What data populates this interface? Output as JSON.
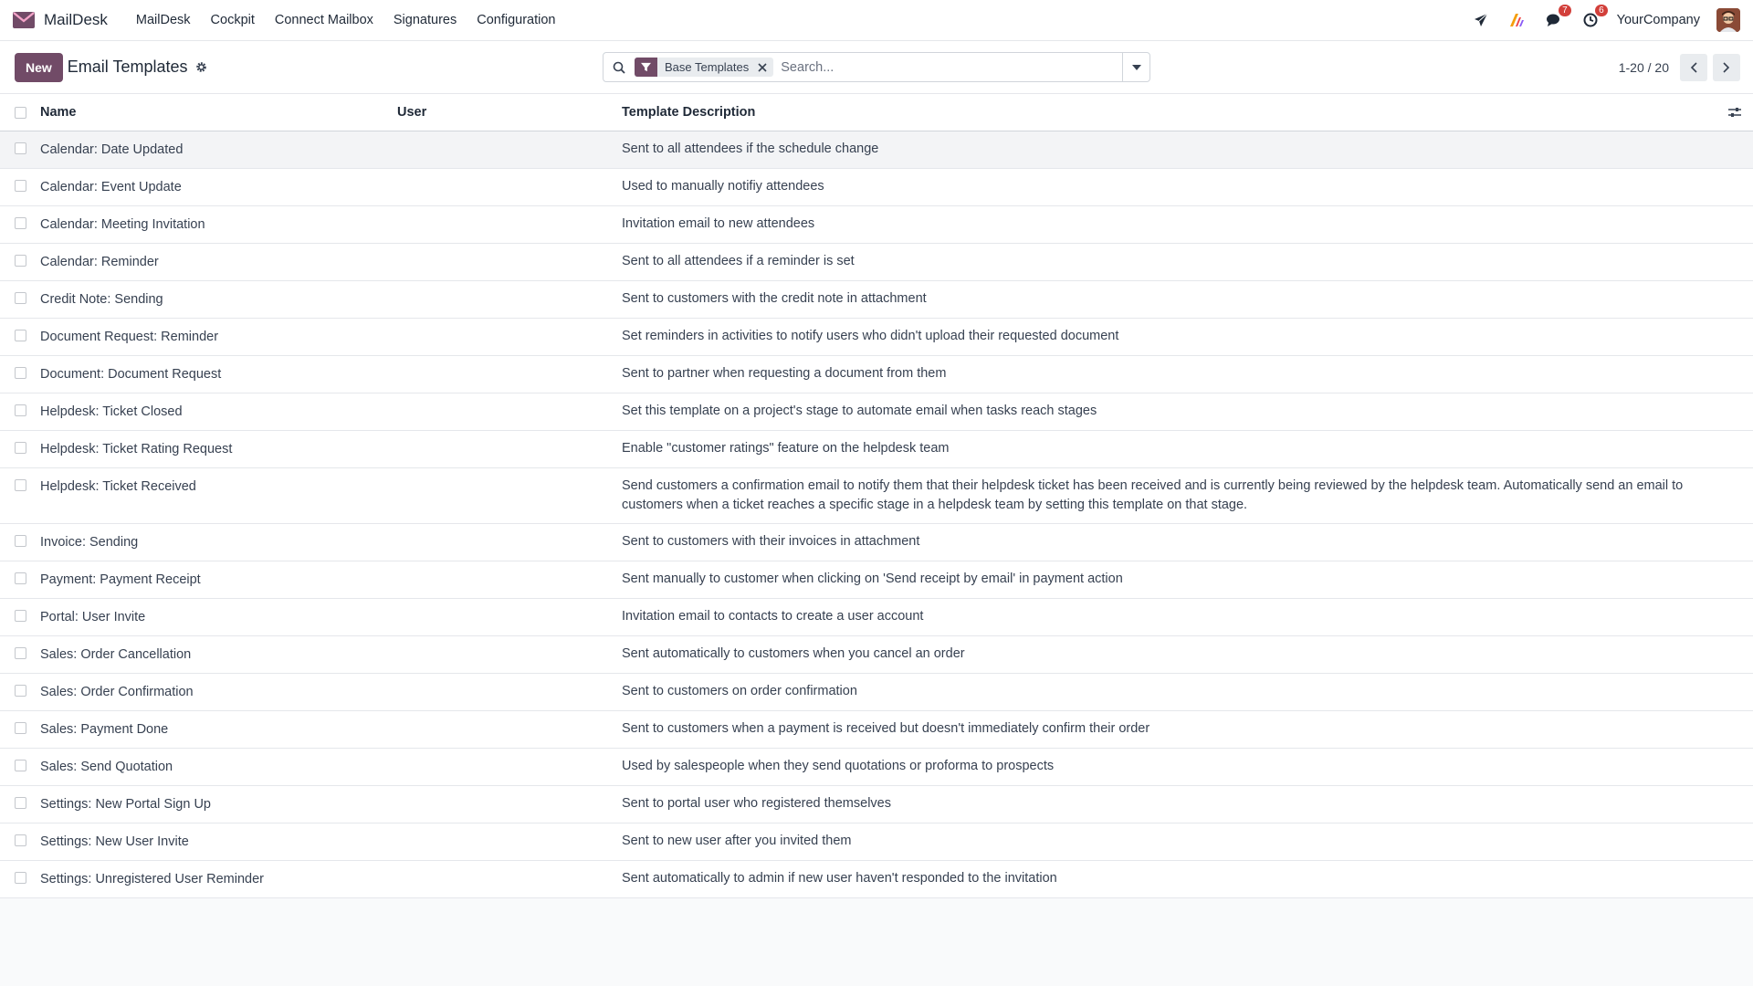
{
  "app": {
    "name": "MailDesk",
    "menu": [
      "MailDesk",
      "Cockpit",
      "Connect Mailbox",
      "Signatures",
      "Configuration"
    ],
    "company": "YourCompany",
    "icons": [
      "paper-plane-icon",
      "app-logo-icon",
      "chat-icon",
      "activity-clock-icon"
    ],
    "badges": {
      "messages": "7",
      "activities": "6"
    },
    "accent": "#714b67"
  },
  "control": {
    "new_label": "New",
    "title": "Email Templates",
    "facet": "Base Templates",
    "search_placeholder": "Search...",
    "pager": "1-20 / 20"
  },
  "table": {
    "headers": {
      "name": "Name",
      "user": "User",
      "desc": "Template Description"
    },
    "rows": [
      {
        "name": "Calendar: Date Updated",
        "user": "",
        "desc": "Sent to all attendees if the schedule change"
      },
      {
        "name": "Calendar: Event Update",
        "user": "",
        "desc": "Used to manually notifiy attendees"
      },
      {
        "name": "Calendar: Meeting Invitation",
        "user": "",
        "desc": "Invitation email to new attendees"
      },
      {
        "name": "Calendar: Reminder",
        "user": "",
        "desc": "Sent to all attendees if a reminder is set"
      },
      {
        "name": "Credit Note: Sending",
        "user": "",
        "desc": "Sent to customers with the credit note in attachment"
      },
      {
        "name": "Document Request: Reminder",
        "user": "",
        "desc": "Set reminders in activities to notify users who didn't upload their requested document"
      },
      {
        "name": "Document: Document Request",
        "user": "",
        "desc": "Sent to partner when requesting a document from them"
      },
      {
        "name": "Helpdesk: Ticket Closed",
        "user": "",
        "desc": "Set this template on a project's stage to automate email when tasks reach stages"
      },
      {
        "name": "Helpdesk: Ticket Rating Request",
        "user": "",
        "desc": "Enable \"customer ratings\" feature on the helpdesk team"
      },
      {
        "name": "Helpdesk: Ticket Received",
        "user": "",
        "desc": "Send customers a confirmation email to notify them that their helpdesk ticket has been received and is currently being reviewed by the helpdesk team. Automatically send an email to customers when a ticket reaches a specific stage in a helpdesk team by setting this template on that stage."
      },
      {
        "name": "Invoice: Sending",
        "user": "",
        "desc": "Sent to customers with their invoices in attachment"
      },
      {
        "name": "Payment: Payment Receipt",
        "user": "",
        "desc": "Sent manually to customer when clicking on 'Send receipt by email' in payment action"
      },
      {
        "name": "Portal: User Invite",
        "user": "",
        "desc": "Invitation email to contacts to create a user account"
      },
      {
        "name": "Sales: Order Cancellation",
        "user": "",
        "desc": "Sent automatically to customers when you cancel an order"
      },
      {
        "name": "Sales: Order Confirmation",
        "user": "",
        "desc": "Sent to customers on order confirmation"
      },
      {
        "name": "Sales: Payment Done",
        "user": "",
        "desc": "Sent to customers when a payment is received but doesn't immediately confirm their order"
      },
      {
        "name": "Sales: Send Quotation",
        "user": "",
        "desc": "Used by salespeople when they send quotations or proforma to prospects"
      },
      {
        "name": "Settings: New Portal Sign Up",
        "user": "",
        "desc": "Sent to portal user who registered themselves"
      },
      {
        "name": "Settings: New User Invite",
        "user": "",
        "desc": "Sent to new user after you invited them"
      },
      {
        "name": "Settings: Unregistered User Reminder",
        "user": "",
        "desc": "Sent automatically to admin if new user haven't responded to the invitation"
      }
    ]
  }
}
